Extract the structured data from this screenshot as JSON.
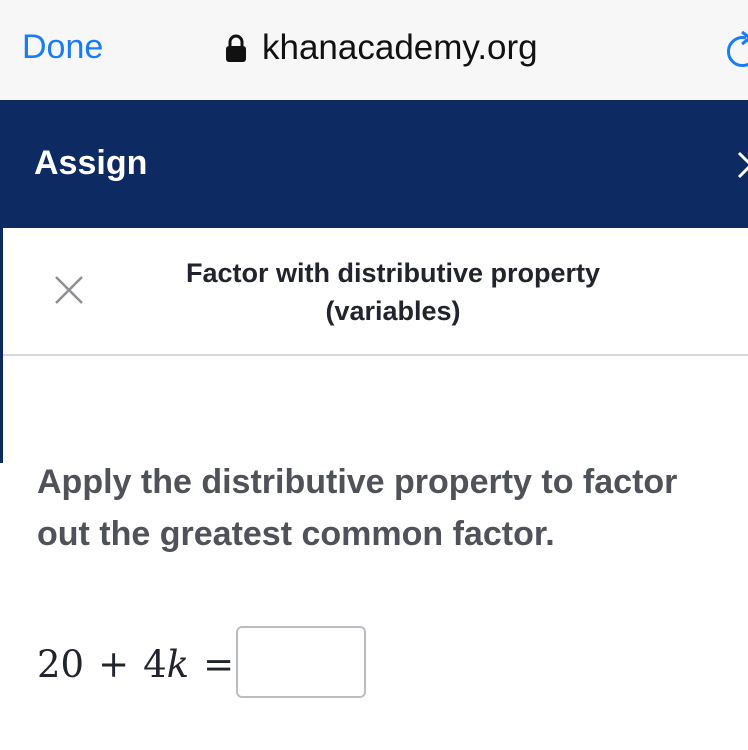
{
  "browser": {
    "done_label": "Done",
    "url": "khanacademy.org",
    "icons": [
      "lock-icon",
      "reload-icon"
    ],
    "accent_color": "#1a7cf5"
  },
  "header": {
    "title": "Assign",
    "background": "#0d2a62",
    "icons": [
      "chevron-right-icon"
    ]
  },
  "modal": {
    "title_line1": "Factor with distributive property",
    "title_line2": "(variables)",
    "close_icon": "close-icon",
    "prompt": "Apply the distributive property to factor out the greatest common factor.",
    "equation": {
      "constant": "20",
      "plus": "+",
      "coefficient": "4",
      "variable": "k",
      "equals": "=",
      "answer_value": ""
    }
  }
}
